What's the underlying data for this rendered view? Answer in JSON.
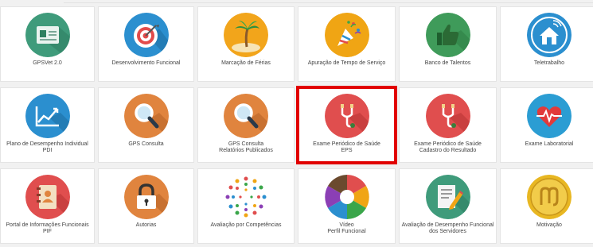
{
  "tiles": [
    {
      "lines": [
        "GPSVet 2.0"
      ],
      "icon": "id-card-icon",
      "color": "#3f9b7b"
    },
    {
      "lines": [
        "Desenvolvimento Funcional"
      ],
      "icon": "target-icon",
      "color": "#2b8fcf"
    },
    {
      "lines": [
        "Marcação de Férias"
      ],
      "icon": "palm-tree-icon",
      "color": "#f2a51b"
    },
    {
      "lines": [
        "Apuração de Tempo de Serviço"
      ],
      "icon": "party-popper-icon",
      "color": "#f0a514"
    },
    {
      "lines": [
        "Banco de Talentos"
      ],
      "icon": "thumbs-up-icon",
      "color": "#3f9b5a"
    },
    {
      "lines": [
        "Teletrabalho"
      ],
      "icon": "smart-home-icon",
      "color": "#2b8fcf"
    },
    {
      "lines": [
        "Plano de Desempenho Individual",
        "PDI"
      ],
      "icon": "growth-chart-icon",
      "color": "#2b8fcf"
    },
    {
      "lines": [
        "GPS Consulta"
      ],
      "icon": "magnifier-icon",
      "color": "#e0843e"
    },
    {
      "lines": [
        "GPS Consulta",
        "Relatórios Publicados"
      ],
      "icon": "magnifier-icon",
      "color": "#e0843e"
    },
    {
      "lines": [
        "Exame Periódico de Saúde",
        "EPS"
      ],
      "icon": "stethoscope-icon",
      "color": "#e04e4e"
    },
    {
      "lines": [
        "Exame Periódico de Saúde",
        "Cadastro do Resultado"
      ],
      "icon": "stethoscope-icon",
      "color": "#e04e4e"
    },
    {
      "lines": [
        "Exame Laboratorial"
      ],
      "icon": "heartbeat-icon",
      "color": "#2b9dd3"
    },
    {
      "lines": [
        "Portal de Informações Funcionais",
        "PIF"
      ],
      "icon": "address-book-icon",
      "color": "#e04e4e"
    },
    {
      "lines": [
        "Autorias"
      ],
      "icon": "padlock-icon",
      "color": "#e0843e"
    },
    {
      "lines": [
        "Avaliação por Competências"
      ],
      "icon": "people-circle-icon",
      "color": "#ffffff"
    },
    {
      "lines": [
        "Vídeo",
        "Perfil Funcional"
      ],
      "icon": "color-wheel-icon",
      "color": "#ffffff"
    },
    {
      "lines": [
        "Avaliação de Desempenho Funcional",
        "dos Servidores"
      ],
      "icon": "document-edit-icon",
      "color": "#3f9b7b"
    },
    {
      "lines": [
        "Motivação"
      ],
      "icon": "gold-coin-icon",
      "color": "#e8b722"
    }
  ]
}
